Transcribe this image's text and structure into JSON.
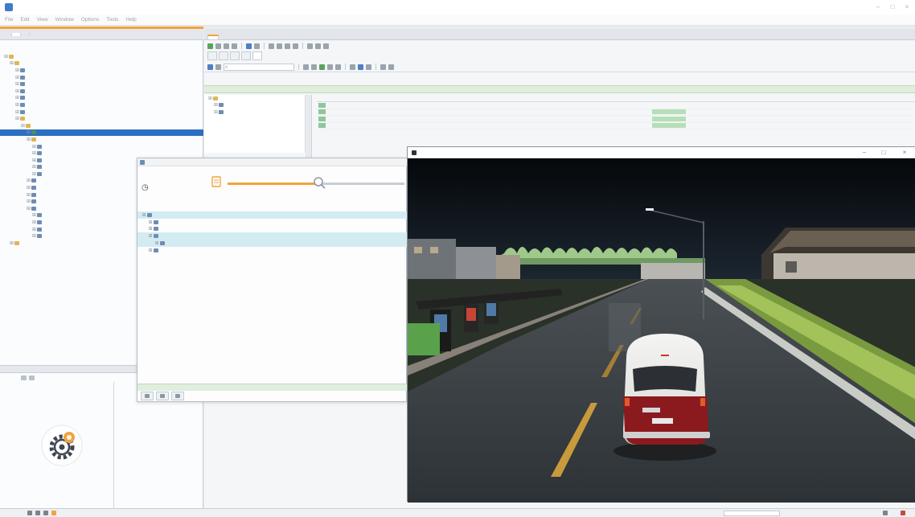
{
  "window": {
    "title": "",
    "menu": [
      "File",
      "Edit",
      "View",
      "Window",
      "Options",
      "Tools",
      "Help"
    ]
  },
  "left_panel": {
    "tabs": [
      "",
      "",
      ""
    ],
    "project_title": "",
    "tree": [
      {
        "level": 0,
        "icon": "folder",
        "label": ""
      },
      {
        "level": 1,
        "icon": "folder",
        "label": ""
      },
      {
        "level": 2,
        "icon": "file",
        "label": ""
      },
      {
        "level": 2,
        "icon": "file",
        "label": ""
      },
      {
        "level": 2,
        "icon": "file",
        "label": ""
      },
      {
        "level": 2,
        "icon": "file",
        "label": ""
      },
      {
        "level": 2,
        "icon": "file",
        "label": ""
      },
      {
        "level": 2,
        "icon": "file",
        "label": ""
      },
      {
        "level": 2,
        "icon": "file",
        "label": ""
      },
      {
        "level": 2,
        "icon": "folder",
        "label": ""
      },
      {
        "level": 3,
        "icon": "folder",
        "label": ""
      },
      {
        "level": 4,
        "icon": "cfg",
        "label": "",
        "selected": true
      },
      {
        "level": 4,
        "icon": "folder",
        "label": ""
      },
      {
        "level": 5,
        "icon": "file",
        "label": ""
      },
      {
        "level": 5,
        "icon": "file",
        "label": ""
      },
      {
        "level": 5,
        "icon": "file",
        "label": ""
      },
      {
        "level": 5,
        "icon": "file",
        "label": ""
      },
      {
        "level": 5,
        "icon": "file",
        "label": ""
      },
      {
        "level": 4,
        "icon": "file",
        "label": ""
      },
      {
        "level": 4,
        "icon": "file",
        "label": ""
      },
      {
        "level": 4,
        "icon": "file",
        "label": ""
      },
      {
        "level": 4,
        "icon": "file",
        "label": ""
      },
      {
        "level": 4,
        "icon": "file",
        "label": ""
      },
      {
        "level": 5,
        "icon": "file",
        "label": ""
      },
      {
        "level": 5,
        "icon": "file",
        "label": ""
      },
      {
        "level": 5,
        "icon": "file",
        "label": ""
      },
      {
        "level": 5,
        "icon": "file",
        "label": ""
      },
      {
        "level": 1,
        "icon": "folder",
        "label": ""
      }
    ]
  },
  "navigator": {
    "header": "",
    "col1": "",
    "col2": ""
  },
  "editor": {
    "tab": "",
    "subtabs": [
      "",
      "",
      "",
      "",
      ""
    ],
    "search_placeholder": "",
    "info_bar": "",
    "mini_tree": [
      "",
      "",
      ""
    ],
    "table_headers": [
      "",
      "",
      "",
      "",
      "",
      "",
      "",
      ""
    ],
    "table_rows": [
      {
        "num": "",
        "name": "",
        "value": ""
      },
      {
        "num": "",
        "name": "",
        "value": ""
      },
      {
        "num": "",
        "name": "",
        "value": ""
      },
      {
        "num": "",
        "name": "",
        "value": ""
      }
    ]
  },
  "progress_dialog": {
    "title": "",
    "headline": "",
    "time": "",
    "progress": 0.52,
    "phase_label": "",
    "list_header": "",
    "list": [
      {
        "level": 0,
        "label": "",
        "highlight": true
      },
      {
        "level": 1,
        "label": "",
        "highlight": false
      },
      {
        "level": 1,
        "label": "",
        "highlight": false
      },
      {
        "level": 1,
        "label": "",
        "highlight": true
      },
      {
        "level": 2,
        "label": "",
        "highlight": true
      },
      {
        "level": 1,
        "label": "",
        "highlight": false
      }
    ],
    "bottom_label": ""
  },
  "simulator": {
    "title": "",
    "van_plate": ""
  },
  "colors": {
    "accent": "#f2a33c",
    "selection": "#2b6fc2",
    "success_bar": "#dfeedd",
    "highlight_row": "#d3ecf2"
  }
}
